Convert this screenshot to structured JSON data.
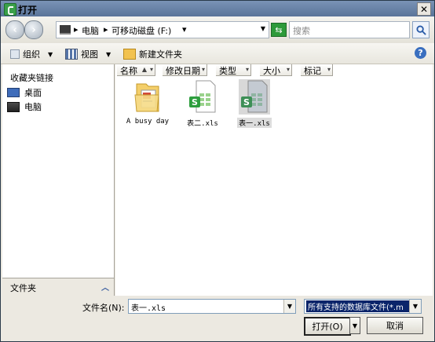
{
  "window": {
    "title": "打开",
    "close_label": "✕"
  },
  "address_bar": {
    "breadcrumbs": [
      "电脑",
      "可移动磁盘 (F:)"
    ],
    "search_placeholder": "搜索"
  },
  "toolbar": {
    "organize_label": "组织",
    "view_label": "视图",
    "new_folder_label": "新建文件夹",
    "help_label": "?"
  },
  "sidebar": {
    "title": "收藏夹链接",
    "items": [
      {
        "label": "桌面",
        "icon": "desktop-icon"
      },
      {
        "label": "电脑",
        "icon": "computer-icon"
      }
    ],
    "folders_label": "文件夹"
  },
  "file_list": {
    "columns": [
      "名称",
      "修改日期",
      "类型",
      "大小",
      "标记"
    ],
    "files": [
      {
        "name": "A busy day",
        "icon": "folder-icon",
        "selected": false
      },
      {
        "name": "表二.xls",
        "icon": "spreadsheet-icon",
        "selected": false
      },
      {
        "name": "表一.xls",
        "icon": "spreadsheet-icon",
        "selected": true
      }
    ]
  },
  "bottom": {
    "filename_label": "文件名(N):",
    "filename_value": "表一.xls",
    "filetype_value": "所有支持的数据库文件(*.m",
    "open_label": "打开(O)",
    "cancel_label": "取消"
  },
  "colors": {
    "title_bar": "#6b86ab",
    "accent_green": "#2d9a3a",
    "selection": "#0a246a"
  }
}
